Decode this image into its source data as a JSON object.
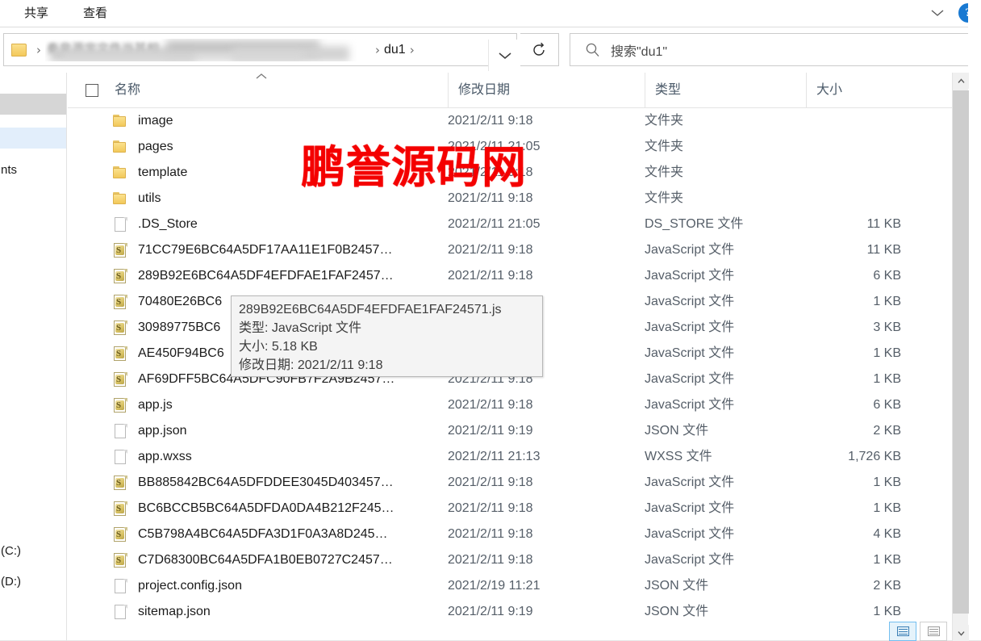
{
  "window": {
    "ribbon_tabs": [
      {
        "label": "共享",
        "name": "ribbon-tab-share"
      },
      {
        "label": "查看",
        "name": "ribbon-tab-view"
      }
    ],
    "collapse_ribbon_icon": "chevron-down-icon",
    "help_icon": "help-icon",
    "help_glyph": "?"
  },
  "addressbar": {
    "folder_icon": "folder-icon",
    "separator": "›",
    "redacted_path_text": "秦皇源宝文件当其相",
    "current_folder": "du1",
    "dropdown_icon": "chevron-down-icon",
    "refresh_icon": "refresh-icon",
    "refresh_glyph": "↻"
  },
  "search": {
    "icon": "search-icon",
    "placeholder": "搜索\"du1\""
  },
  "navpane": {
    "items": [
      {
        "label": "",
        "state": "blurred"
      },
      {
        "label": "",
        "state": "selected"
      },
      {
        "label": "nts",
        "state": "normal"
      },
      {
        "label": "(C:)",
        "state": "normal"
      },
      {
        "label": "(D:)",
        "state": "normal"
      }
    ]
  },
  "columns": {
    "checkbox": "select-all-checkbox",
    "sort_indicator": "︿",
    "headers": [
      {
        "label": "名称",
        "key": "name"
      },
      {
        "label": "修改日期",
        "key": "date"
      },
      {
        "label": "类型",
        "key": "type"
      },
      {
        "label": "大小",
        "key": "size"
      }
    ]
  },
  "files": [
    {
      "name": "image",
      "date": "2021/2/11 9:18",
      "type": "文件夹",
      "size": "",
      "icon": "folder-icon"
    },
    {
      "name": "pages",
      "date": "2021/2/11 21:05",
      "type": "文件夹",
      "size": "",
      "icon": "folder-icon"
    },
    {
      "name": "template",
      "date": "2021/2/11 9:18",
      "type": "文件夹",
      "size": "",
      "icon": "folder-icon"
    },
    {
      "name": "utils",
      "date": "2021/2/11 9:18",
      "type": "文件夹",
      "size": "",
      "icon": "folder-icon"
    },
    {
      "name": ".DS_Store",
      "date": "2021/2/11 21:05",
      "type": "DS_STORE 文件",
      "size": "11 KB",
      "icon": "file-icon"
    },
    {
      "name": "71CC79E6BC64A5DF17AA11E1F0B2457…",
      "date": "2021/2/11 9:18",
      "type": "JavaScript 文件",
      "size": "11 KB",
      "icon": "javascript-file-icon"
    },
    {
      "name": "289B92E6BC64A5DF4EFDFAE1FAF2457…",
      "date": "2021/2/11 9:18",
      "type": "JavaScript 文件",
      "size": "6 KB",
      "icon": "javascript-file-icon"
    },
    {
      "name": "70480E26BC6",
      "date": "",
      "type": "JavaScript 文件",
      "size": "1 KB",
      "icon": "javascript-file-icon"
    },
    {
      "name": "30989775BC6",
      "date": "",
      "type": "JavaScript 文件",
      "size": "3 KB",
      "icon": "javascript-file-icon"
    },
    {
      "name": "AE450F94BC6",
      "date": "",
      "type": "JavaScript 文件",
      "size": "1 KB",
      "icon": "javascript-file-icon"
    },
    {
      "name": "AF69DFF5BC64A5DFC90FB7F2A9B2457…",
      "date": "2021/2/11 9:18",
      "type": "JavaScript 文件",
      "size": "1 KB",
      "icon": "javascript-file-icon"
    },
    {
      "name": "app.js",
      "date": "2021/2/11 9:18",
      "type": "JavaScript 文件",
      "size": "6 KB",
      "icon": "javascript-file-icon"
    },
    {
      "name": "app.json",
      "date": "2021/2/11 9:19",
      "type": "JSON 文件",
      "size": "2 KB",
      "icon": "file-icon"
    },
    {
      "name": "app.wxss",
      "date": "2021/2/11 21:13",
      "type": "WXSS 文件",
      "size": "1,726 KB",
      "icon": "file-icon"
    },
    {
      "name": "BB885842BC64A5DFDDEE3045D403457…",
      "date": "2021/2/11 9:18",
      "type": "JavaScript 文件",
      "size": "1 KB",
      "icon": "javascript-file-icon"
    },
    {
      "name": "BC6BCCB5BC64A5DFDA0DA4B212F245…",
      "date": "2021/2/11 9:18",
      "type": "JavaScript 文件",
      "size": "1 KB",
      "icon": "javascript-file-icon"
    },
    {
      "name": "C5B798A4BC64A5DFA3D1F0A3A8D245…",
      "date": "2021/2/11 9:18",
      "type": "JavaScript 文件",
      "size": "4 KB",
      "icon": "javascript-file-icon"
    },
    {
      "name": "C7D68300BC64A5DFA1B0EB0727C2457…",
      "date": "2021/2/11 9:18",
      "type": "JavaScript 文件",
      "size": "1 KB",
      "icon": "javascript-file-icon"
    },
    {
      "name": "project.config.json",
      "date": "2021/2/19 11:21",
      "type": "JSON 文件",
      "size": "2 KB",
      "icon": "file-icon"
    },
    {
      "name": "sitemap.json",
      "date": "2021/2/11 9:19",
      "type": "JSON 文件",
      "size": "1 KB",
      "icon": "file-icon"
    }
  ],
  "tooltip": {
    "title": "289B92E6BC64A5DF4EFDFAE1FAF24571.js",
    "line_type": "类型: JavaScript 文件",
    "line_size": "大小: 5.18 KB",
    "line_date": "修改日期: 2021/2/11 9:18"
  },
  "watermark": {
    "text": "鹏誉源码网",
    "color": "#f40000"
  },
  "scrollbar": {
    "up_icon": "scroll-up-arrow-icon",
    "down_icon": "scroll-down-arrow-icon"
  },
  "view_buttons": [
    {
      "name": "details-view-button",
      "icon": "details-view-icon",
      "active": true
    },
    {
      "name": "large-icons-view-button",
      "icon": "large-icons-view-icon",
      "active": false
    }
  ]
}
